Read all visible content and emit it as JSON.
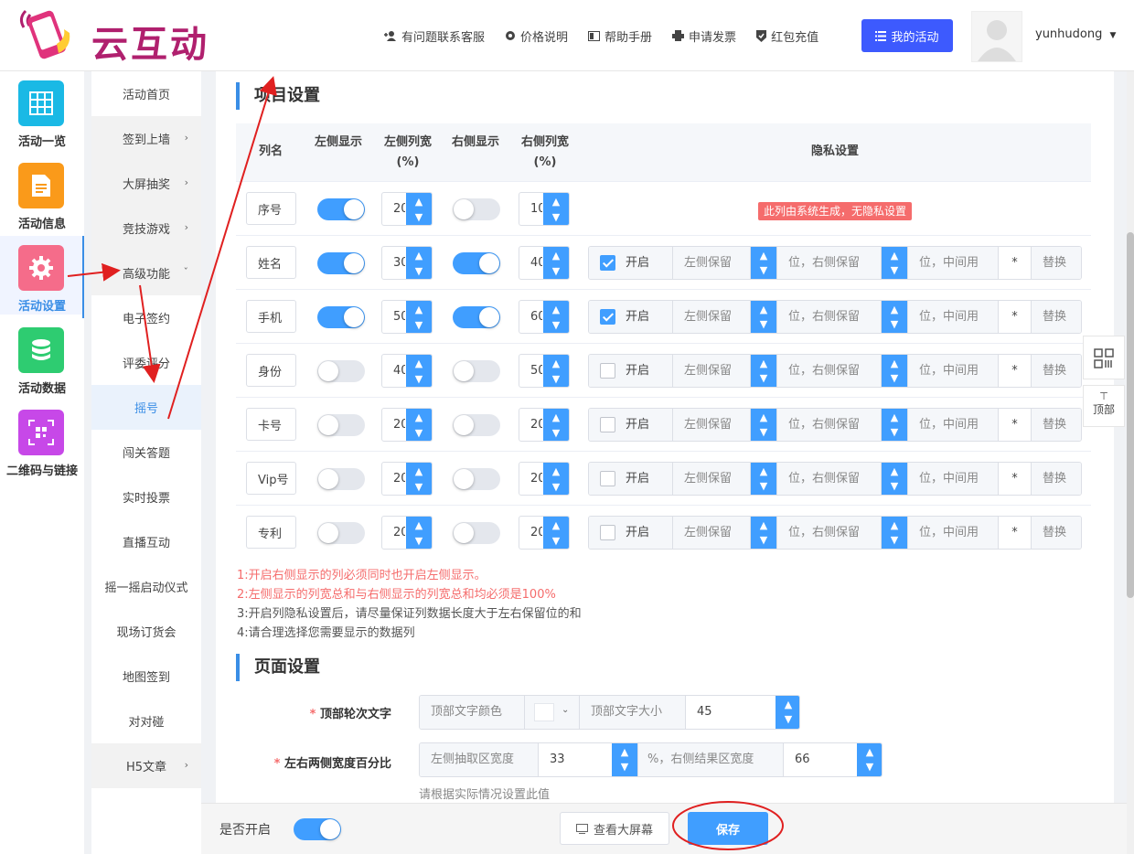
{
  "header": {
    "logo_text": "云互动",
    "nav": [
      "有问题联系客服",
      "价格说明",
      "帮助手册",
      "申请发票",
      "红包充值"
    ],
    "my_activity": "我的活动",
    "username": "yunhudong"
  },
  "left_nav": [
    "活动一览",
    "活动信息",
    "活动设置",
    "活动数据",
    "二维码与链接"
  ],
  "sub_nav": [
    "活动首页",
    "签到上墙",
    "大屏抽奖",
    "竞技游戏",
    "高级功能",
    "电子签约",
    "评委评分",
    "摇号",
    "闯关答题",
    "实时投票",
    "直播互动",
    "摇一摇启动仪式",
    "现场订货会",
    "地图签到",
    "对对碰",
    "H5文章"
  ],
  "project": {
    "title": "项目设置",
    "headers": {
      "col_name": "列名",
      "left_show": "左侧显示",
      "left_width": "左侧列宽(%)",
      "right_show": "右侧显示",
      "right_width": "右侧列宽(%)",
      "privacy": "隐私设置"
    },
    "system_badge": "此列由系统生成，无隐私设置",
    "privacy_labels": {
      "enable": "开启",
      "left_keep": "左侧保留",
      "right_keep": "位，右侧保留",
      "middle": "位，中间用",
      "star": "*",
      "replace": "替换"
    },
    "rows": [
      {
        "name": "序号",
        "left_on": true,
        "left_w": "20",
        "right_on": false,
        "right_w": "10",
        "privacy_on": false
      },
      {
        "name": "姓名",
        "left_on": true,
        "left_w": "30",
        "right_on": true,
        "right_w": "40",
        "privacy_on": true
      },
      {
        "name": "手机",
        "left_on": true,
        "left_w": "50",
        "right_on": true,
        "right_w": "60",
        "privacy_on": true
      },
      {
        "name": "身份",
        "left_on": false,
        "left_w": "40",
        "right_on": false,
        "right_w": "50",
        "privacy_on": false
      },
      {
        "name": "卡号",
        "left_on": false,
        "left_w": "20",
        "right_on": false,
        "right_w": "20",
        "privacy_on": false
      },
      {
        "name": "Vip号",
        "left_on": false,
        "left_w": "20",
        "right_on": false,
        "right_w": "20",
        "privacy_on": false
      },
      {
        "name": "专利",
        "left_on": false,
        "left_w": "20",
        "right_on": false,
        "right_w": "20",
        "privacy_on": false
      }
    ],
    "notes": [
      "1:开启右侧显示的列必须同时也开启左侧显示。",
      "2:左侧显示的列宽总和与右侧显示的列宽总和均必须是100%",
      "3:开启列隐私设置后，请尽量保证列数据长度大于左右保留位的和",
      "4:请合理选择您需要显示的数据列"
    ]
  },
  "page": {
    "title": "页面设置",
    "top_label": "顶部轮次文字",
    "top_color": "顶部文字颜色",
    "top_size": "顶部文字大小",
    "top_size_value": "45",
    "ratio_label": "左右两侧宽度百分比",
    "left_area": "左侧抽取区宽度",
    "left_value": "33",
    "right_area": "%，右侧结果区宽度",
    "right_value": "66",
    "hint": "请根据实际情况设置此值"
  },
  "footer": {
    "enable_label": "是否开启",
    "preview": "查看大屏幕",
    "save": "保存"
  },
  "float": {
    "top": "顶部"
  },
  "colors": {
    "accent": "#409eff",
    "brand": "#b0206e",
    "danger": "#f56c6c",
    "annotation": "#e02020"
  }
}
